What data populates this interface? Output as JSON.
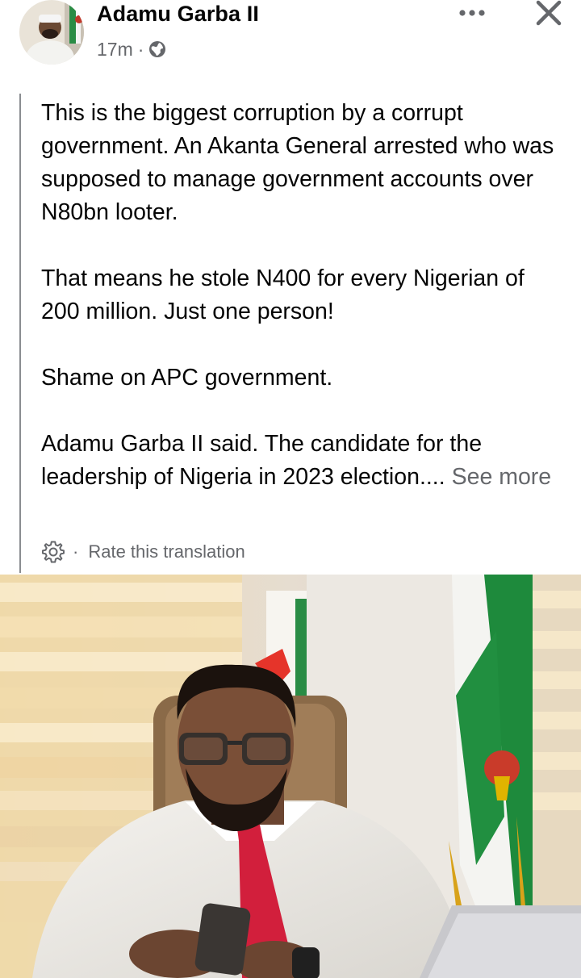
{
  "post": {
    "author": "Adamu Garba II",
    "time": "17m",
    "separator": "·",
    "audience_icon": "globe-icon",
    "paragraphs": [
      "This is the biggest corruption by a corrupt government. An Akanta General arrested who was supposed to manage government accounts over N80bn looter.",
      "That means he stole N400 for every Nigerian of 200 million. Just one person!",
      "Shame on APC government.",
      "Adamu Garba II said. The candidate for the leadership of Nigeria in 2023 election...."
    ],
    "see_more": "See more",
    "translation_separator": "·",
    "rate_translation": "Rate this translation"
  },
  "icons": {
    "more": "more-options-icon",
    "close": "close-icon",
    "translation": "gear-icon"
  },
  "colors": {
    "text": "#050505",
    "secondary": "#65676b",
    "quote_bar": "#8a8d91",
    "tie": "#d21f3c",
    "flag_green": "#1a8a3a"
  }
}
